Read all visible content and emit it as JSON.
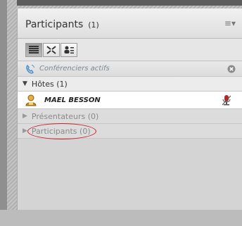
{
  "panel": {
    "title": "Participants",
    "count": "(1)",
    "menu_glyph": "≡▾"
  },
  "toolbar": {
    "buttons": [
      {
        "icon": "list-view-icon",
        "active": true
      },
      {
        "icon": "fullscreen-icon",
        "active": false
      },
      {
        "icon": "attendee-status-icon",
        "active": false
      }
    ]
  },
  "speakers": {
    "label": "Conférenciers actifs",
    "icon": "phone-icon",
    "close_icon": "close-circle-icon"
  },
  "sections": {
    "hosts": {
      "label": "Hôtes (1)",
      "expanded": true
    },
    "presenters": {
      "label": "Présentateurs (0)",
      "expanded": false
    },
    "participants": {
      "label": "Participants (0)",
      "expanded": false
    }
  },
  "users": [
    {
      "name": "MAEL BESSON",
      "role_icon": "host-user-icon",
      "status_icon": "microphone-muted-icon"
    }
  ],
  "colors": {
    "highlight_circle": "#c8202a",
    "panel_bg": "#d4d4d4"
  }
}
